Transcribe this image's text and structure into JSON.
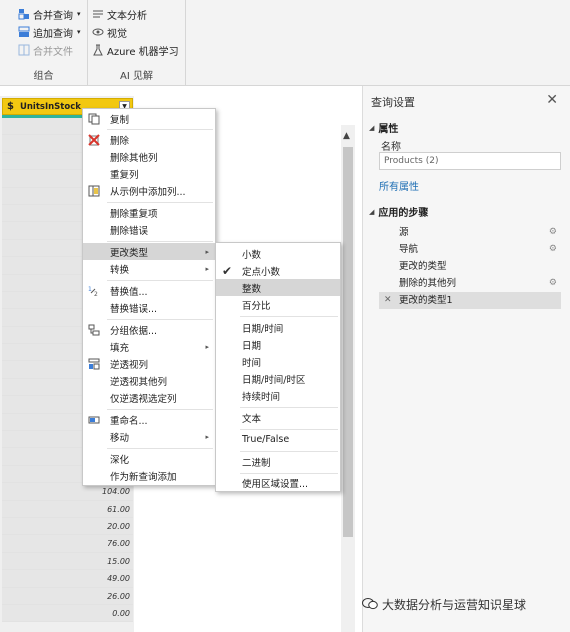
{
  "ribbon": {
    "group_combine": {
      "label": "组合",
      "items": [
        {
          "label": "合并查询",
          "caret": "▾",
          "icon": "merge-query-icon"
        },
        {
          "label": "追加查询",
          "caret": "▾",
          "icon": "append-query-icon"
        },
        {
          "label": "合并文件",
          "icon": "combine-files-icon"
        }
      ]
    },
    "group_ai": {
      "label": "AI 见解",
      "items": [
        {
          "label": "文本分析",
          "icon": "text-analytics-icon"
        },
        {
          "label": "视觉",
          "icon": "vision-icon"
        },
        {
          "label": "Azure 机器学习",
          "icon": "azure-ml-icon"
        }
      ]
    }
  },
  "grid": {
    "column_header": "UnitsInStock",
    "column_icon": "$",
    "visible_values": [
      "104.00",
      "61.00",
      "20.00",
      "76.00",
      "15.00",
      "49.00",
      "26.00",
      "0.00"
    ]
  },
  "context_menu": {
    "items": [
      {
        "label": "复制",
        "icon": "copy-icon"
      },
      {
        "label": "删除",
        "icon": "delete-icon"
      },
      {
        "label": "删除其他列"
      },
      {
        "label": "重复列"
      },
      {
        "label": "从示例中添加列...",
        "icon": "add-column-from-examples-icon"
      },
      {
        "label": "删除重复项"
      },
      {
        "label": "删除错误"
      },
      {
        "label": "更改类型",
        "submenu": "▸"
      },
      {
        "label": "转换",
        "submenu": "▸"
      },
      {
        "label": "替换值...",
        "icon": "replace-values-icon"
      },
      {
        "label": "替换错误..."
      },
      {
        "label": "分组依据...",
        "icon": "group-by-icon"
      },
      {
        "label": "填充",
        "submenu": "▸"
      },
      {
        "label": "逆透视列",
        "icon": "unpivot-icon"
      },
      {
        "label": "逆透视其他列"
      },
      {
        "label": "仅逆透视选定列"
      },
      {
        "label": "重命名...",
        "icon": "rename-icon"
      },
      {
        "label": "移动",
        "submenu": "▸"
      },
      {
        "label": "深化"
      },
      {
        "label": "作为新查询添加"
      }
    ]
  },
  "type_submenu": {
    "items": [
      {
        "label": "小数"
      },
      {
        "label": "定点小数",
        "checked": true
      },
      {
        "label": "整数",
        "highlighted": true
      },
      {
        "label": "百分比"
      },
      {
        "label": "日期/时间"
      },
      {
        "label": "日期"
      },
      {
        "label": "时间"
      },
      {
        "label": "日期/时间/时区"
      },
      {
        "label": "持续时间"
      },
      {
        "label": "文本"
      },
      {
        "label": "True/False"
      },
      {
        "label": "二进制"
      },
      {
        "label": "使用区域设置..."
      }
    ]
  },
  "query_settings": {
    "title": "查询设置",
    "properties_label": "属性",
    "name_label": "名称",
    "name_value": "Products (2)",
    "all_properties_link": "所有属性",
    "applied_steps_label": "应用的步骤",
    "steps": [
      {
        "label": "源",
        "gear": true
      },
      {
        "label": "导航",
        "gear": true
      },
      {
        "label": "更改的类型"
      },
      {
        "label": "删除的其他列",
        "gear": true
      },
      {
        "label": "更改的类型1",
        "active": true
      }
    ]
  },
  "watermark": "大数据分析与运营知识星球",
  "colors": {
    "column_header": "#f2c811",
    "column_bar": "#2fb39b",
    "link": "#1f6fb4"
  }
}
